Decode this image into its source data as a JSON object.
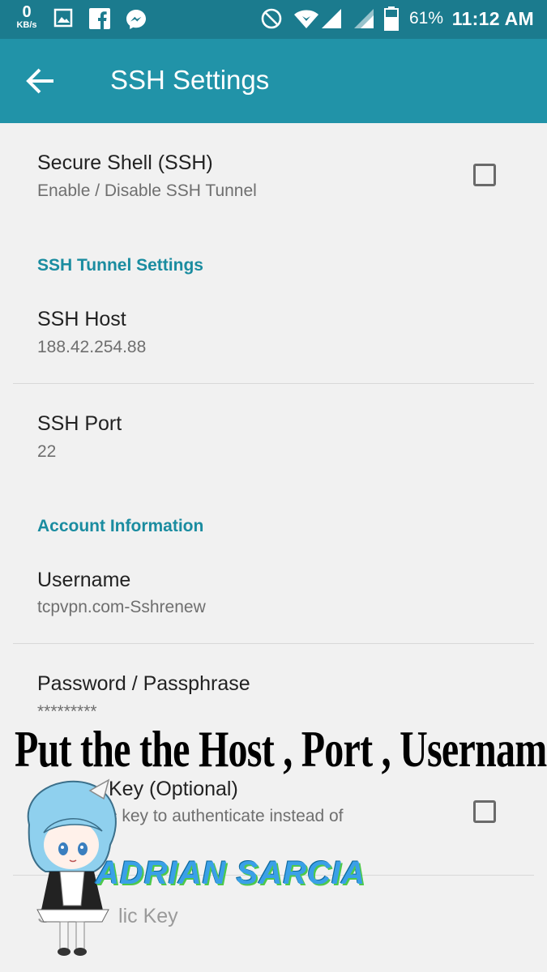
{
  "status_bar": {
    "speed_value": "0",
    "speed_unit": "KB/s",
    "battery": "61%",
    "time": "11:12 AM",
    "icons": [
      "gallery-icon",
      "facebook-icon",
      "messenger-icon",
      "do-not-disturb-icon",
      "wifi-icon",
      "signal-icon",
      "signal-icon",
      "battery-icon"
    ]
  },
  "toolbar": {
    "title": "SSH Settings",
    "back_icon": "arrow-back-icon"
  },
  "items": {
    "ssh": {
      "title": "Secure Shell (SSH)",
      "summary": "Enable / Disable SSH Tunnel",
      "checked": false
    },
    "tunnel_category": "SSH Tunnel Settings",
    "host": {
      "title": "SSH Host",
      "summary": "188.42.254.88"
    },
    "port": {
      "title": "SSH Port",
      "summary": "22"
    },
    "account_category": "Account Information",
    "username": {
      "title": "Username",
      "summary": "tcpvpn.com-Sshrenew"
    },
    "password": {
      "title": "Password / Passphrase",
      "summary": "*********"
    },
    "public_key": {
      "title": "Key (Optional)",
      "summary": "c key to authenticate instead of",
      "checked": false
    },
    "select_key": {
      "title": "S            lic Key"
    }
  },
  "overlay": {
    "caption": "Put the the Host , Port , Username",
    "watermark": "ADRIAN SARCIA"
  },
  "colors": {
    "status_bar": "#1b7b8e",
    "toolbar": "#2193a8",
    "accent": "#1a8ca0",
    "background": "#f1f1f1"
  }
}
